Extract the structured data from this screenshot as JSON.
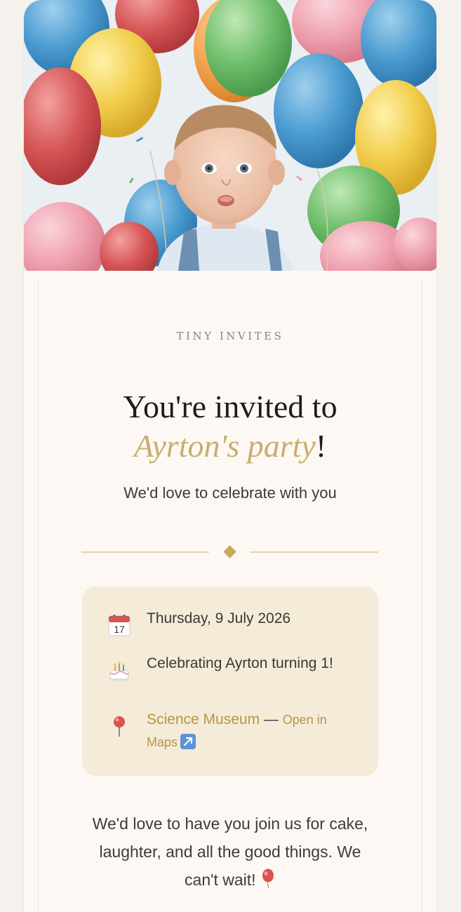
{
  "brand": "TINY INVITES",
  "headline": {
    "line1": "You're invited to",
    "name": "Ayrton's party",
    "punct": "!"
  },
  "subtitle": "We'd love to celebrate with you",
  "details": {
    "date": "Thursday, 9 July 2026",
    "calendar_day": "17",
    "occasion": "Celebrating Ayrton turning 1!",
    "location": "Science Museum",
    "location_sep": "—",
    "maps_label_1": "Open in",
    "maps_label_2": "Maps"
  },
  "message": "We'd love to have you join us for cake, laughter, and all the good things. We can't wait!",
  "icons": {
    "date": "calendar-icon",
    "occasion": "birthday-cake-icon",
    "location": "round-pushpin-icon",
    "maps": "external-link-arrow-icon",
    "message": "balloon-icon"
  },
  "colors": {
    "accent_gold": "#c7ae6e",
    "link_gold": "#b99445",
    "card_bg": "#fdf8f3",
    "details_bg": "#f4ebd8"
  }
}
